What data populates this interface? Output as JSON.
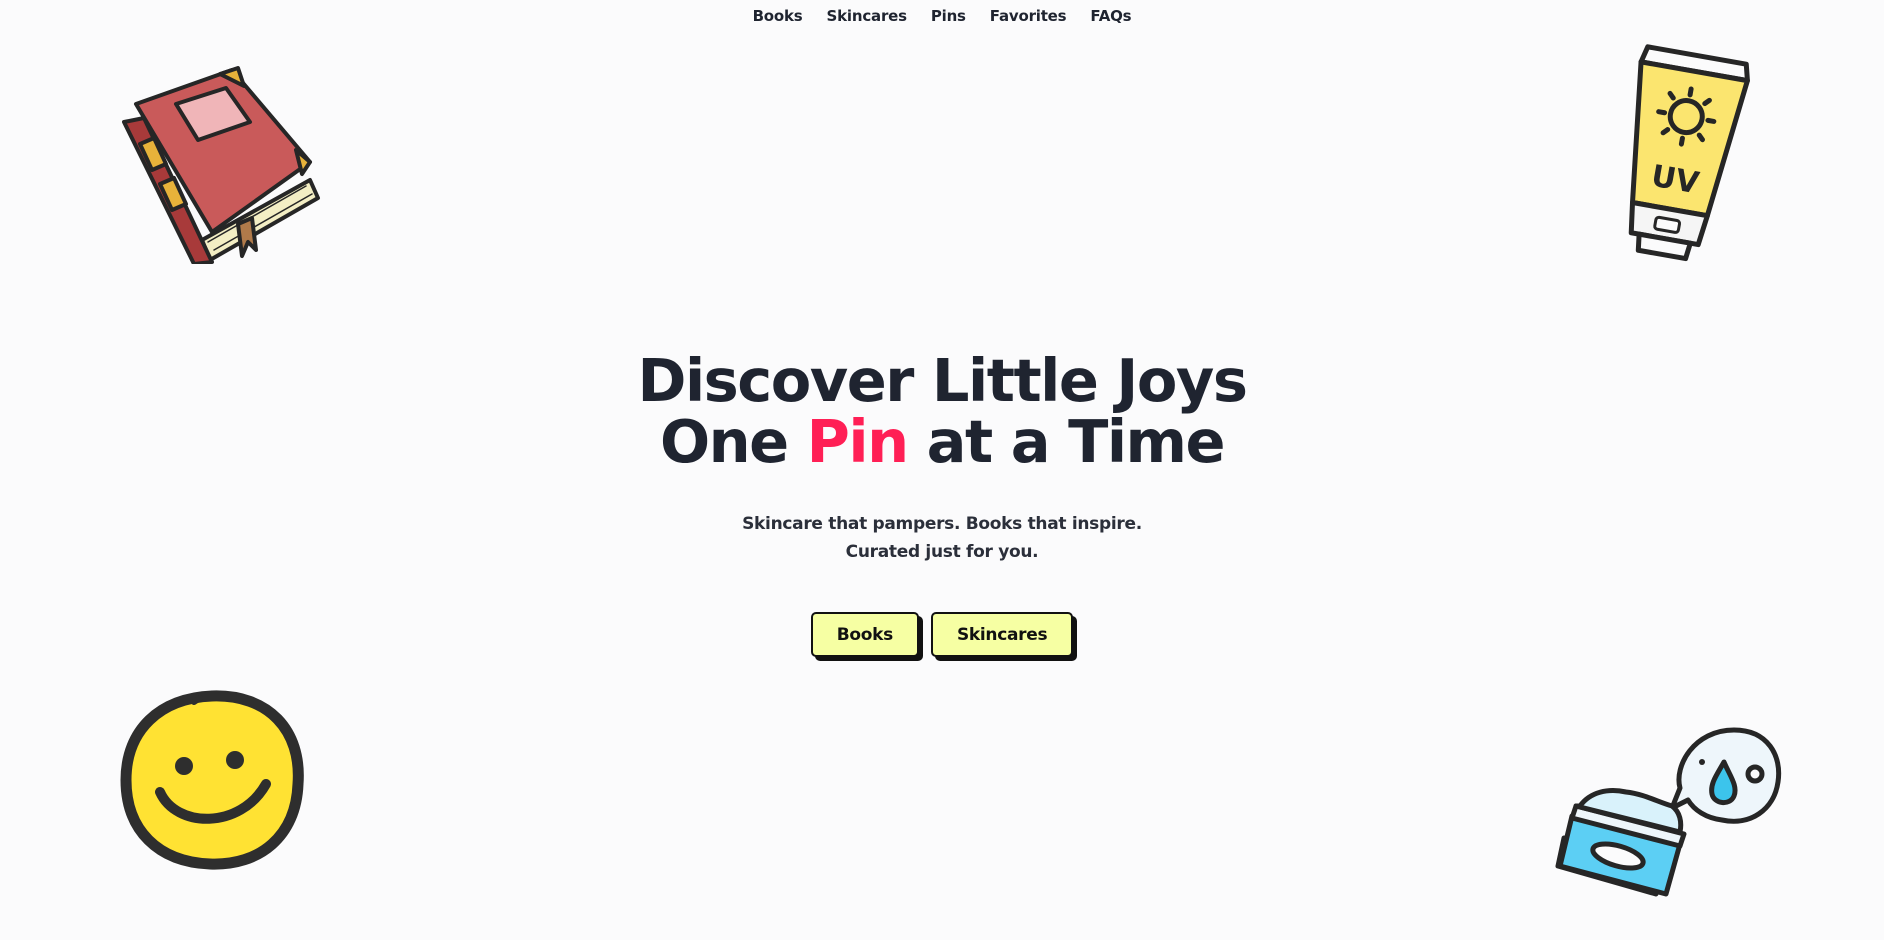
{
  "nav": {
    "items": [
      {
        "label": "Books"
      },
      {
        "label": "Skincares"
      },
      {
        "label": "Pins"
      },
      {
        "label": "Favorites"
      },
      {
        "label": "FAQs"
      }
    ]
  },
  "hero": {
    "line1": "Discover Little Joys",
    "line2_before": "One ",
    "line2_accent": "Pin",
    "line2_after": " at a Time",
    "subtitle_line1": "Skincare that pampers. Books that inspire.",
    "subtitle_line2": "Curated just for you."
  },
  "cta": {
    "books_label": "Books",
    "skincares_label": "Skincares"
  },
  "illustrations": {
    "book": "book-icon",
    "sunscreen": "sunscreen-tube-icon",
    "sunscreen_text": "UV",
    "smiley": "smiley-face-icon",
    "cream": "moisturizer-jar-icon"
  },
  "colors": {
    "background": "#fbfbfc",
    "text": "#1f2430",
    "accent": "#ff1f55",
    "button": "#f6ffa3"
  }
}
